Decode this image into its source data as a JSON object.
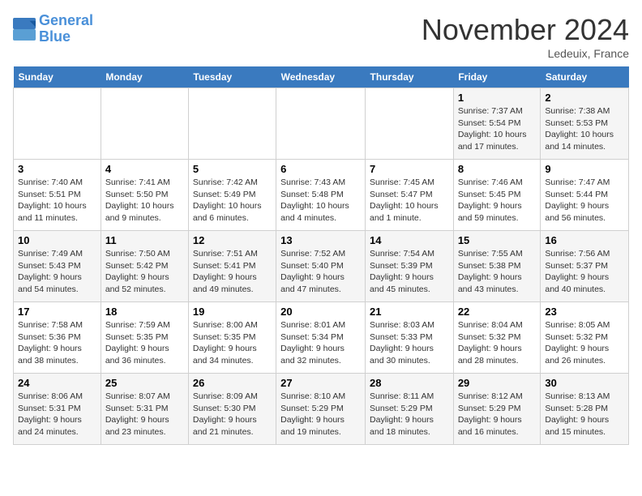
{
  "header": {
    "logo_line1": "General",
    "logo_line2": "Blue",
    "month_title": "November 2024",
    "location": "Ledeuix, France"
  },
  "weekdays": [
    "Sunday",
    "Monday",
    "Tuesday",
    "Wednesday",
    "Thursday",
    "Friday",
    "Saturday"
  ],
  "weeks": [
    [
      {
        "day": "",
        "info": ""
      },
      {
        "day": "",
        "info": ""
      },
      {
        "day": "",
        "info": ""
      },
      {
        "day": "",
        "info": ""
      },
      {
        "day": "",
        "info": ""
      },
      {
        "day": "1",
        "info": "Sunrise: 7:37 AM\nSunset: 5:54 PM\nDaylight: 10 hours and 17 minutes."
      },
      {
        "day": "2",
        "info": "Sunrise: 7:38 AM\nSunset: 5:53 PM\nDaylight: 10 hours and 14 minutes."
      }
    ],
    [
      {
        "day": "3",
        "info": "Sunrise: 7:40 AM\nSunset: 5:51 PM\nDaylight: 10 hours and 11 minutes."
      },
      {
        "day": "4",
        "info": "Sunrise: 7:41 AM\nSunset: 5:50 PM\nDaylight: 10 hours and 9 minutes."
      },
      {
        "day": "5",
        "info": "Sunrise: 7:42 AM\nSunset: 5:49 PM\nDaylight: 10 hours and 6 minutes."
      },
      {
        "day": "6",
        "info": "Sunrise: 7:43 AM\nSunset: 5:48 PM\nDaylight: 10 hours and 4 minutes."
      },
      {
        "day": "7",
        "info": "Sunrise: 7:45 AM\nSunset: 5:47 PM\nDaylight: 10 hours and 1 minute."
      },
      {
        "day": "8",
        "info": "Sunrise: 7:46 AM\nSunset: 5:45 PM\nDaylight: 9 hours and 59 minutes."
      },
      {
        "day": "9",
        "info": "Sunrise: 7:47 AM\nSunset: 5:44 PM\nDaylight: 9 hours and 56 minutes."
      }
    ],
    [
      {
        "day": "10",
        "info": "Sunrise: 7:49 AM\nSunset: 5:43 PM\nDaylight: 9 hours and 54 minutes."
      },
      {
        "day": "11",
        "info": "Sunrise: 7:50 AM\nSunset: 5:42 PM\nDaylight: 9 hours and 52 minutes."
      },
      {
        "day": "12",
        "info": "Sunrise: 7:51 AM\nSunset: 5:41 PM\nDaylight: 9 hours and 49 minutes."
      },
      {
        "day": "13",
        "info": "Sunrise: 7:52 AM\nSunset: 5:40 PM\nDaylight: 9 hours and 47 minutes."
      },
      {
        "day": "14",
        "info": "Sunrise: 7:54 AM\nSunset: 5:39 PM\nDaylight: 9 hours and 45 minutes."
      },
      {
        "day": "15",
        "info": "Sunrise: 7:55 AM\nSunset: 5:38 PM\nDaylight: 9 hours and 43 minutes."
      },
      {
        "day": "16",
        "info": "Sunrise: 7:56 AM\nSunset: 5:37 PM\nDaylight: 9 hours and 40 minutes."
      }
    ],
    [
      {
        "day": "17",
        "info": "Sunrise: 7:58 AM\nSunset: 5:36 PM\nDaylight: 9 hours and 38 minutes."
      },
      {
        "day": "18",
        "info": "Sunrise: 7:59 AM\nSunset: 5:35 PM\nDaylight: 9 hours and 36 minutes."
      },
      {
        "day": "19",
        "info": "Sunrise: 8:00 AM\nSunset: 5:35 PM\nDaylight: 9 hours and 34 minutes."
      },
      {
        "day": "20",
        "info": "Sunrise: 8:01 AM\nSunset: 5:34 PM\nDaylight: 9 hours and 32 minutes."
      },
      {
        "day": "21",
        "info": "Sunrise: 8:03 AM\nSunset: 5:33 PM\nDaylight: 9 hours and 30 minutes."
      },
      {
        "day": "22",
        "info": "Sunrise: 8:04 AM\nSunset: 5:32 PM\nDaylight: 9 hours and 28 minutes."
      },
      {
        "day": "23",
        "info": "Sunrise: 8:05 AM\nSunset: 5:32 PM\nDaylight: 9 hours and 26 minutes."
      }
    ],
    [
      {
        "day": "24",
        "info": "Sunrise: 8:06 AM\nSunset: 5:31 PM\nDaylight: 9 hours and 24 minutes."
      },
      {
        "day": "25",
        "info": "Sunrise: 8:07 AM\nSunset: 5:31 PM\nDaylight: 9 hours and 23 minutes."
      },
      {
        "day": "26",
        "info": "Sunrise: 8:09 AM\nSunset: 5:30 PM\nDaylight: 9 hours and 21 minutes."
      },
      {
        "day": "27",
        "info": "Sunrise: 8:10 AM\nSunset: 5:29 PM\nDaylight: 9 hours and 19 minutes."
      },
      {
        "day": "28",
        "info": "Sunrise: 8:11 AM\nSunset: 5:29 PM\nDaylight: 9 hours and 18 minutes."
      },
      {
        "day": "29",
        "info": "Sunrise: 8:12 AM\nSunset: 5:29 PM\nDaylight: 9 hours and 16 minutes."
      },
      {
        "day": "30",
        "info": "Sunrise: 8:13 AM\nSunset: 5:28 PM\nDaylight: 9 hours and 15 minutes."
      }
    ]
  ]
}
